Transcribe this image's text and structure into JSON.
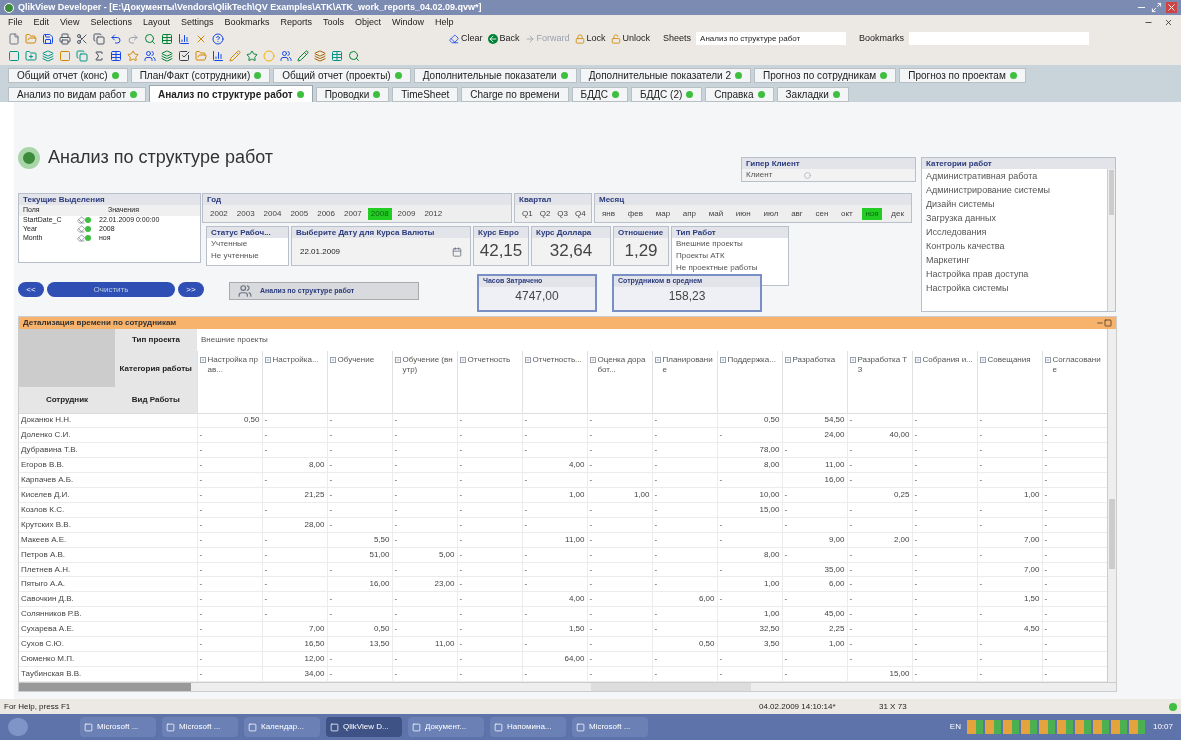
{
  "window": {
    "title": "QlikView Developer - [E:\\Документы\\Vendors\\QlikTech\\QV Examples\\ATK\\ATK_work_reports_04.02.09.qvw*]"
  },
  "menu": [
    "File",
    "Edit",
    "View",
    "Selections",
    "Layout",
    "Settings",
    "Bookmarks",
    "Reports",
    "Tools",
    "Object",
    "Window",
    "Help"
  ],
  "toolbar": {
    "clear": "Clear",
    "back": "Back",
    "forward": "Forward",
    "lock": "Lock",
    "unlock": "Unlock",
    "sheets_label": "Sheets",
    "sheet_select": "Анализ по структуре работ",
    "bookmarks_label": "Bookmarks"
  },
  "sheet_tabs_row1": [
    {
      "label": "Общий отчет (конс)",
      "selected": false,
      "dot": true
    },
    {
      "label": "План/Факт (сотрудники)",
      "selected": false,
      "dot": true
    },
    {
      "label": "Общий отчет (проекты)",
      "selected": false,
      "dot": true
    },
    {
      "label": "Дополнительные показатели",
      "selected": false,
      "dot": true
    },
    {
      "label": "Дополнительные показатели 2",
      "selected": false,
      "dot": true
    },
    {
      "label": "Прогноз по сотрудникам",
      "selected": false,
      "dot": true
    },
    {
      "label": "Прогноз по проектам",
      "selected": false,
      "dot": true
    }
  ],
  "sheet_tabs_row2": [
    {
      "label": "Анализ по видам работ",
      "selected": false,
      "dot": true
    },
    {
      "label": "Анализ по структуре работ",
      "selected": true,
      "dot": true
    },
    {
      "label": "Проводки",
      "selected": false,
      "dot": true
    },
    {
      "label": "TimeSheet",
      "selected": false,
      "dot": false
    },
    {
      "label": "Charge по времени",
      "selected": false,
      "dot": false
    },
    {
      "label": "БДДС",
      "selected": false,
      "dot": true
    },
    {
      "label": "БДДС (2)",
      "selected": false,
      "dot": true
    },
    {
      "label": "Справка",
      "selected": false,
      "dot": true
    },
    {
      "label": "Закладки",
      "selected": false,
      "dot": true
    }
  ],
  "sheet": {
    "title": "Анализ по структуре работ",
    "current_selections": {
      "title": "Текущие Выделения",
      "columns": [
        "Поля",
        "Значения"
      ],
      "rows": [
        {
          "field": "StartDate_C",
          "value": "22.01.2009 0:00:00"
        },
        {
          "field": "Year",
          "value": "2008"
        },
        {
          "field": "Month",
          "value": "ноя"
        }
      ]
    },
    "nav_buttons": {
      "prev": "<<",
      "clear": "Очистить",
      "next": ">>"
    },
    "year": {
      "title": "Год",
      "items": [
        {
          "label": "2002",
          "selected": false
        },
        {
          "label": "2003",
          "selected": false
        },
        {
          "label": "2004",
          "selected": false
        },
        {
          "label": "2005",
          "selected": false
        },
        {
          "label": "2006",
          "selected": false
        },
        {
          "label": "2007",
          "selected": false
        },
        {
          "label": "2008",
          "selected": true
        },
        {
          "label": "2009",
          "selected": false
        },
        {
          "label": "2012",
          "selected": false
        }
      ]
    },
    "quarter": {
      "title": "Квартал",
      "items": [
        {
          "label": "Q1",
          "selected": false
        },
        {
          "label": "Q2",
          "selected": false
        },
        {
          "label": "Q3",
          "selected": false
        },
        {
          "label": "Q4",
          "selected": false
        }
      ]
    },
    "month": {
      "title": "Месяц",
      "items": [
        {
          "label": "янв",
          "selected": false
        },
        {
          "label": "фев",
          "selected": false
        },
        {
          "label": "мар",
          "selected": false
        },
        {
          "label": "апр",
          "selected": false
        },
        {
          "label": "май",
          "selected": false
        },
        {
          "label": "июн",
          "selected": false
        },
        {
          "label": "июл",
          "selected": false
        },
        {
          "label": "авг",
          "selected": false
        },
        {
          "label": "сен",
          "selected": false
        },
        {
          "label": "окт",
          "selected": false
        },
        {
          "label": "ноя",
          "selected": true
        },
        {
          "label": "дек",
          "selected": false
        }
      ]
    },
    "status": {
      "title": "Статус Рабоч...",
      "items": [
        "Учтенные",
        "Не учтенные"
      ]
    },
    "date_picker": {
      "title": "Выберите Дату для Курса Валюты",
      "value": "22.01.2009"
    },
    "rates": [
      {
        "title": "Курс Евро",
        "value": "42,15"
      },
      {
        "title": "Курс Доллара",
        "value": "32,64"
      },
      {
        "title": "Отношение",
        "value": "1,29"
      }
    ],
    "work_type": {
      "title": "Тип Работ",
      "items": [
        "Внешние проекты",
        "Проекты АТК",
        "Не проектные работы"
      ]
    },
    "action_button": "Анализ по структуре работ",
    "hours": {
      "title": "Часов Затрачено",
      "value": "4747,00"
    },
    "average": {
      "title": "Сотрудником в среднем",
      "value": "158,23"
    },
    "hyper_client": {
      "title": "Гипер Клиент",
      "value": "Клиент"
    },
    "categories": {
      "title": "Категории работ",
      "items": [
        "Административная работа",
        "Администрирование системы",
        "Дизайн системы",
        "Загрузка данных",
        "Исследования",
        "Контроль качества",
        "Маркетинг",
        "Настройка прав доступа",
        "Настройка системы"
      ]
    }
  },
  "table": {
    "title": "Детализация времени по сотрудникам",
    "dimension_labels": {
      "project_type": "Тип проекта",
      "category": "Категория работы",
      "employee": "Сотрудник",
      "work_kind": "Вид Работы"
    },
    "project_type": "Внешние проекты",
    "columns": [
      "Настройка прав...",
      "Настройка...",
      "Обучение",
      "Обучение (внутр)",
      "Отчетность",
      "Отчетность...",
      "Оценка доработ...",
      "Планирование",
      "Поддержка...",
      "Разработка",
      "Разработка ТЗ",
      "Собрания и...",
      "Совещания",
      "Согласование"
    ],
    "rows": [
      {
        "name": "Доканюк Н.Н.",
        "cells": [
          "0,50",
          "-",
          "-",
          "-",
          "-",
          "-",
          "-",
          "-",
          "0,50",
          "54,50",
          "-",
          "-",
          "-",
          "-"
        ]
      },
      {
        "name": "Доленко С.И.",
        "cells": [
          "-",
          "-",
          "-",
          "-",
          "-",
          "-",
          "-",
          "-",
          "-",
          "24,00",
          "40,00",
          "-",
          "-",
          "-"
        ]
      },
      {
        "name": "Дубравина Т.В.",
        "cells": [
          "-",
          "-",
          "-",
          "-",
          "-",
          "-",
          "-",
          "-",
          "78,00",
          "-",
          "-",
          "-",
          "-",
          "-"
        ]
      },
      {
        "name": "Егоров В.В.",
        "cells": [
          "-",
          "8,00",
          "-",
          "-",
          "-",
          "4,00",
          "-",
          "-",
          "8,00",
          "11,00",
          "-",
          "-",
          "-",
          "-"
        ]
      },
      {
        "name": "Карпачев А.Б.",
        "cells": [
          "-",
          "-",
          "-",
          "-",
          "-",
          "-",
          "-",
          "-",
          "-",
          "16,00",
          "-",
          "-",
          "-",
          "-"
        ]
      },
      {
        "name": "Киселев Д.И.",
        "cells": [
          "-",
          "21,25",
          "-",
          "-",
          "-",
          "1,00",
          "1,00",
          "-",
          "10,00",
          "-",
          "0,25",
          "-",
          "1,00",
          "-"
        ]
      },
      {
        "name": "Козлов К.С.",
        "cells": [
          "-",
          "-",
          "-",
          "-",
          "-",
          "-",
          "-",
          "-",
          "15,00",
          "-",
          "-",
          "-",
          "-",
          "-"
        ]
      },
      {
        "name": "Крутских В.В.",
        "cells": [
          "-",
          "28,00",
          "-",
          "-",
          "-",
          "-",
          "-",
          "-",
          "-",
          "-",
          "-",
          "-",
          "-",
          "-"
        ]
      },
      {
        "name": "Макеев А.Е.",
        "cells": [
          "-",
          "-",
          "5,50",
          "-",
          "-",
          "11,00",
          "-",
          "-",
          "-",
          "9,00",
          "2,00",
          "-",
          "7,00",
          "-"
        ]
      },
      {
        "name": "Петров А.В.",
        "cells": [
          "-",
          "-",
          "51,00",
          "5,00",
          "-",
          "-",
          "-",
          "-",
          "8,00",
          "-",
          "-",
          "-",
          "-",
          "-"
        ]
      },
      {
        "name": "Плетнев А.Н.",
        "cells": [
          "-",
          "-",
          "-",
          "-",
          "-",
          "-",
          "-",
          "-",
          "-",
          "35,00",
          "-",
          "-",
          "7,00",
          "-"
        ]
      },
      {
        "name": "Пятыго А.А.",
        "cells": [
          "-",
          "-",
          "16,00",
          "23,00",
          "-",
          "-",
          "-",
          "-",
          "1,00",
          "6,00",
          "-",
          "-",
          "-",
          "-"
        ]
      },
      {
        "name": "Савочкин Д.В.",
        "cells": [
          "-",
          "-",
          "-",
          "-",
          "-",
          "4,00",
          "-",
          "6,00",
          "-",
          "-",
          "-",
          "-",
          "1,50",
          "-"
        ]
      },
      {
        "name": "Солянников Р.В.",
        "cells": [
          "-",
          "-",
          "-",
          "-",
          "-",
          "-",
          "-",
          "-",
          "1,00",
          "45,00",
          "-",
          "-",
          "-",
          "-"
        ]
      },
      {
        "name": "Сухарева А.Е.",
        "cells": [
          "-",
          "7,00",
          "0,50",
          "-",
          "-",
          "1,50",
          "-",
          "-",
          "32,50",
          "2,25",
          "-",
          "-",
          "4,50",
          "-"
        ]
      },
      {
        "name": "Сухов С.Ю.",
        "cells": [
          "-",
          "16,50",
          "13,50",
          "11,00",
          "-",
          "-",
          "-",
          "0,50",
          "3,50",
          "1,00",
          "-",
          "-",
          "-",
          "-"
        ]
      },
      {
        "name": "Сюменко М.П.",
        "cells": [
          "-",
          "12,00",
          "-",
          "-",
          "-",
          "64,00",
          "-",
          "-",
          "-",
          "-",
          "-",
          "-",
          "-",
          "-"
        ]
      },
      {
        "name": "Таубинская В.В.",
        "cells": [
          "-",
          "34,00",
          "-",
          "-",
          "-",
          "-",
          "-",
          "-",
          "-",
          "-",
          "15,00",
          "-",
          "-",
          "-"
        ]
      }
    ]
  },
  "status_bar": {
    "help": "For Help, press F1",
    "timestamp": "04.02.2009 14:10:14*",
    "size": "31 X 73"
  },
  "taskbar": {
    "items": [
      {
        "label": "Microsoft ...",
        "selected": false
      },
      {
        "label": "Microsoft ...",
        "selected": false
      },
      {
        "label": "Календар...",
        "selected": false
      },
      {
        "label": "QlikView D...",
        "selected": true
      },
      {
        "label": "Документ...",
        "selected": false
      },
      {
        "label": "Напомина...",
        "selected": false
      },
      {
        "label": "Microsoft ...",
        "selected": false
      }
    ],
    "lang": "EN",
    "time": "10:07"
  }
}
